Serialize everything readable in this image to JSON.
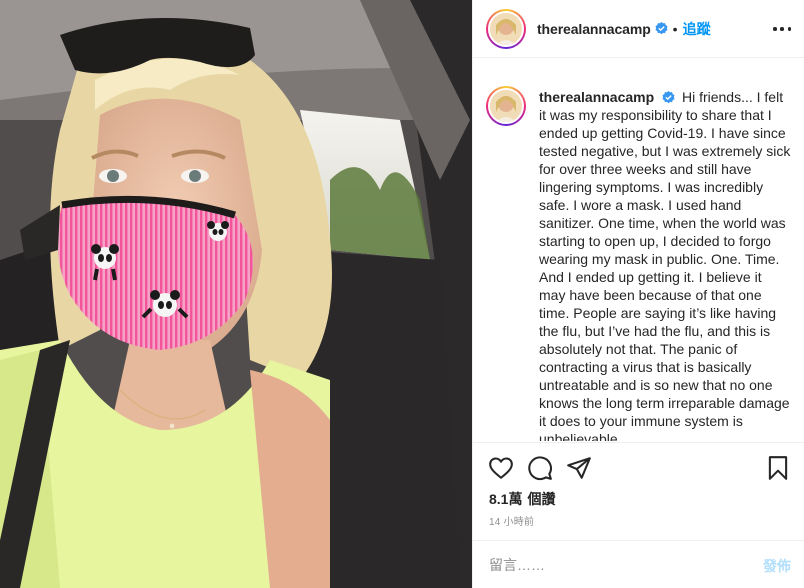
{
  "post": {
    "username": "therealannacamp",
    "verified": true,
    "separator": "•",
    "follow_label": "追蹤",
    "more_options_icon": "ellipsis-icon",
    "caption": "Hi friends... I felt it was my responsibility to share that I ended up getting Covid-19. I have since tested negative, but I was extremely sick for over three weeks and still have lingering symptoms. I was incredibly safe. I wore a mask. I used hand sanitizer. One time, when the world was starting to open up, I decided to forgo wearing my mask in public. One. Time. And I ended up getting it. I believe it may have been because of that one time. People are saying it’s like having the flu, but I’ve had the flu, and this is absolutely not that. The panic of contracting a virus that is basically untreatable and is so new that no one knows the long term irreparable damage it does to your immune system is unbelievable.",
    "likes_count": "8.1萬",
    "likes_suffix": "個讚",
    "timestamp": "14 小時前",
    "comment_placeholder": "留言……",
    "post_button_label": "發佈"
  },
  "icons": {
    "like": "heart-icon",
    "comment": "comment-icon",
    "share": "paper-plane-icon",
    "save": "bookmark-icon",
    "verified": "verified-badge-icon"
  },
  "colors": {
    "link_blue": "#0095f6",
    "post_disabled": "#b2dffc",
    "muted_text": "#8e8e8e",
    "border": "#efefef",
    "verified_badge": "#3897f0"
  }
}
